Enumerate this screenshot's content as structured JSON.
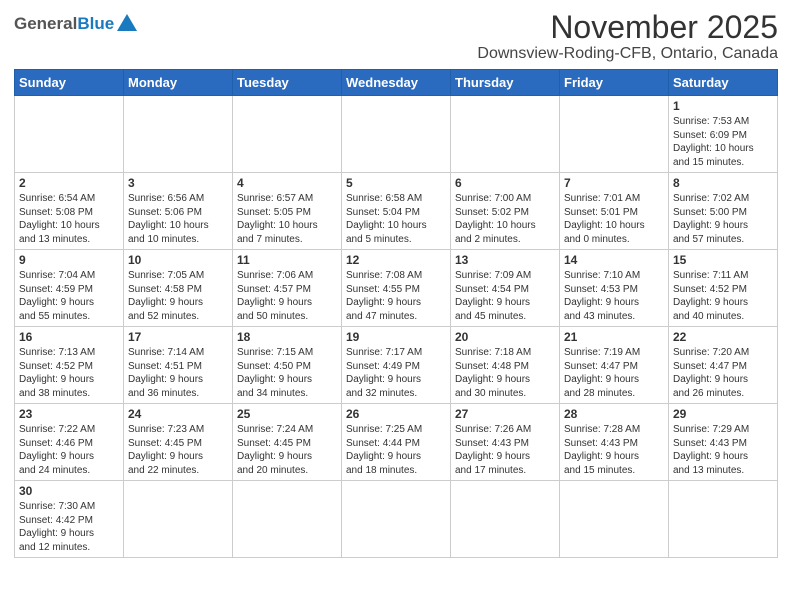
{
  "header": {
    "logo_general": "General",
    "logo_blue": "Blue",
    "title": "November 2025",
    "subtitle": "Downsview-Roding-CFB, Ontario, Canada"
  },
  "weekdays": [
    "Sunday",
    "Monday",
    "Tuesday",
    "Wednesday",
    "Thursday",
    "Friday",
    "Saturday"
  ],
  "weeks": [
    [
      {
        "day": "",
        "info": ""
      },
      {
        "day": "",
        "info": ""
      },
      {
        "day": "",
        "info": ""
      },
      {
        "day": "",
        "info": ""
      },
      {
        "day": "",
        "info": ""
      },
      {
        "day": "",
        "info": ""
      },
      {
        "day": "1",
        "info": "Sunrise: 7:53 AM\nSunset: 6:09 PM\nDaylight: 10 hours\nand 15 minutes."
      }
    ],
    [
      {
        "day": "2",
        "info": "Sunrise: 6:54 AM\nSunset: 5:08 PM\nDaylight: 10 hours\nand 13 minutes."
      },
      {
        "day": "3",
        "info": "Sunrise: 6:56 AM\nSunset: 5:06 PM\nDaylight: 10 hours\nand 10 minutes."
      },
      {
        "day": "4",
        "info": "Sunrise: 6:57 AM\nSunset: 5:05 PM\nDaylight: 10 hours\nand 7 minutes."
      },
      {
        "day": "5",
        "info": "Sunrise: 6:58 AM\nSunset: 5:04 PM\nDaylight: 10 hours\nand 5 minutes."
      },
      {
        "day": "6",
        "info": "Sunrise: 7:00 AM\nSunset: 5:02 PM\nDaylight: 10 hours\nand 2 minutes."
      },
      {
        "day": "7",
        "info": "Sunrise: 7:01 AM\nSunset: 5:01 PM\nDaylight: 10 hours\nand 0 minutes."
      },
      {
        "day": "8",
        "info": "Sunrise: 7:02 AM\nSunset: 5:00 PM\nDaylight: 9 hours\nand 57 minutes."
      }
    ],
    [
      {
        "day": "9",
        "info": "Sunrise: 7:04 AM\nSunset: 4:59 PM\nDaylight: 9 hours\nand 55 minutes."
      },
      {
        "day": "10",
        "info": "Sunrise: 7:05 AM\nSunset: 4:58 PM\nDaylight: 9 hours\nand 52 minutes."
      },
      {
        "day": "11",
        "info": "Sunrise: 7:06 AM\nSunset: 4:57 PM\nDaylight: 9 hours\nand 50 minutes."
      },
      {
        "day": "12",
        "info": "Sunrise: 7:08 AM\nSunset: 4:55 PM\nDaylight: 9 hours\nand 47 minutes."
      },
      {
        "day": "13",
        "info": "Sunrise: 7:09 AM\nSunset: 4:54 PM\nDaylight: 9 hours\nand 45 minutes."
      },
      {
        "day": "14",
        "info": "Sunrise: 7:10 AM\nSunset: 4:53 PM\nDaylight: 9 hours\nand 43 minutes."
      },
      {
        "day": "15",
        "info": "Sunrise: 7:11 AM\nSunset: 4:52 PM\nDaylight: 9 hours\nand 40 minutes."
      }
    ],
    [
      {
        "day": "16",
        "info": "Sunrise: 7:13 AM\nSunset: 4:52 PM\nDaylight: 9 hours\nand 38 minutes."
      },
      {
        "day": "17",
        "info": "Sunrise: 7:14 AM\nSunset: 4:51 PM\nDaylight: 9 hours\nand 36 minutes."
      },
      {
        "day": "18",
        "info": "Sunrise: 7:15 AM\nSunset: 4:50 PM\nDaylight: 9 hours\nand 34 minutes."
      },
      {
        "day": "19",
        "info": "Sunrise: 7:17 AM\nSunset: 4:49 PM\nDaylight: 9 hours\nand 32 minutes."
      },
      {
        "day": "20",
        "info": "Sunrise: 7:18 AM\nSunset: 4:48 PM\nDaylight: 9 hours\nand 30 minutes."
      },
      {
        "day": "21",
        "info": "Sunrise: 7:19 AM\nSunset: 4:47 PM\nDaylight: 9 hours\nand 28 minutes."
      },
      {
        "day": "22",
        "info": "Sunrise: 7:20 AM\nSunset: 4:47 PM\nDaylight: 9 hours\nand 26 minutes."
      }
    ],
    [
      {
        "day": "23",
        "info": "Sunrise: 7:22 AM\nSunset: 4:46 PM\nDaylight: 9 hours\nand 24 minutes."
      },
      {
        "day": "24",
        "info": "Sunrise: 7:23 AM\nSunset: 4:45 PM\nDaylight: 9 hours\nand 22 minutes."
      },
      {
        "day": "25",
        "info": "Sunrise: 7:24 AM\nSunset: 4:45 PM\nDaylight: 9 hours\nand 20 minutes."
      },
      {
        "day": "26",
        "info": "Sunrise: 7:25 AM\nSunset: 4:44 PM\nDaylight: 9 hours\nand 18 minutes."
      },
      {
        "day": "27",
        "info": "Sunrise: 7:26 AM\nSunset: 4:43 PM\nDaylight: 9 hours\nand 17 minutes."
      },
      {
        "day": "28",
        "info": "Sunrise: 7:28 AM\nSunset: 4:43 PM\nDaylight: 9 hours\nand 15 minutes."
      },
      {
        "day": "29",
        "info": "Sunrise: 7:29 AM\nSunset: 4:43 PM\nDaylight: 9 hours\nand 13 minutes."
      }
    ],
    [
      {
        "day": "30",
        "info": "Sunrise: 7:30 AM\nSunset: 4:42 PM\nDaylight: 9 hours\nand 12 minutes."
      },
      {
        "day": "",
        "info": ""
      },
      {
        "day": "",
        "info": ""
      },
      {
        "day": "",
        "info": ""
      },
      {
        "day": "",
        "info": ""
      },
      {
        "day": "",
        "info": ""
      },
      {
        "day": "",
        "info": ""
      }
    ]
  ]
}
